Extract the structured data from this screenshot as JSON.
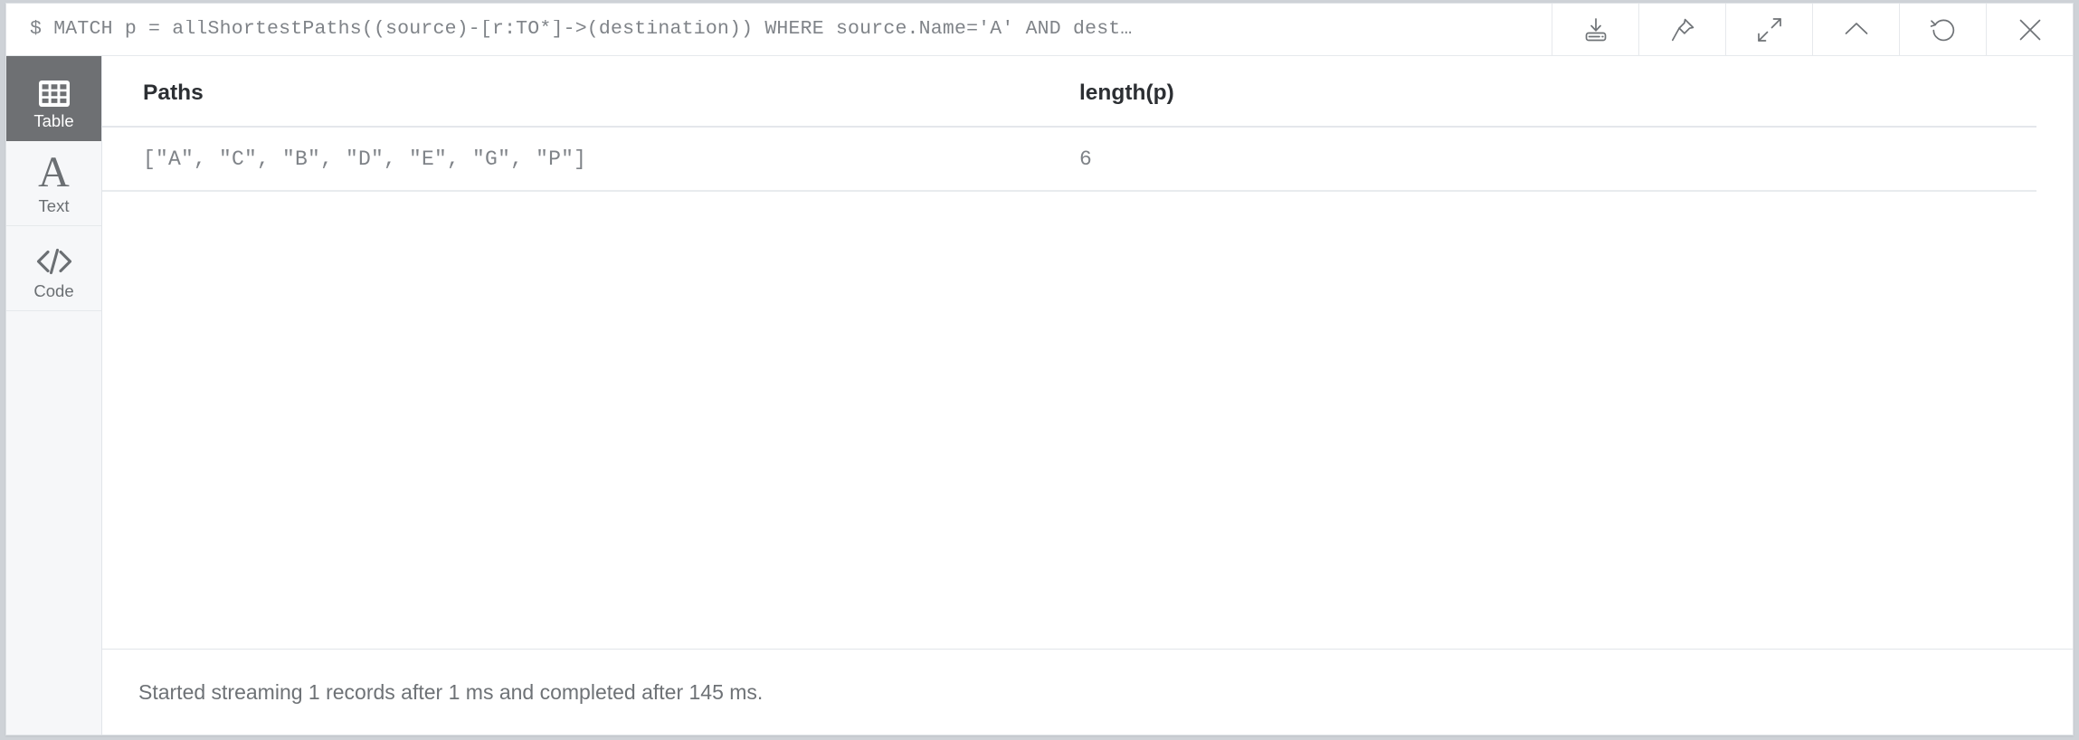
{
  "frame": {
    "query_prompt": "$",
    "query_text": "$ MATCH p = allShortestPaths((source)-[r:TO*]->(destination)) WHERE source.Name='A' AND dest…"
  },
  "toolbar": {
    "buttons": [
      {
        "name": "download-button",
        "icon": "download-icon",
        "label": "Download"
      },
      {
        "name": "pin-button",
        "icon": "pin-icon",
        "label": "Pin"
      },
      {
        "name": "expand-button",
        "icon": "expand-icon",
        "label": "Expand"
      },
      {
        "name": "collapse-button",
        "icon": "chevron-up-icon",
        "label": "Collapse"
      },
      {
        "name": "rerun-button",
        "icon": "refresh-icon",
        "label": "Rerun"
      },
      {
        "name": "close-button",
        "icon": "close-icon",
        "label": "Close"
      }
    ]
  },
  "sidebar": {
    "items": [
      {
        "label": "Table",
        "icon": "table-grid-icon",
        "active": true
      },
      {
        "label": "Text",
        "icon": "letter-a-icon",
        "active": false
      },
      {
        "label": "Code",
        "icon": "code-brackets-icon",
        "active": false
      }
    ]
  },
  "result_table": {
    "columns": [
      "Paths",
      "length(p)"
    ],
    "rows": [
      [
        "[\"A\", \"C\", \"B\", \"D\", \"E\", \"G\", \"P\"]",
        "6"
      ]
    ]
  },
  "status": {
    "message": "Started streaming 1 records after 1 ms and completed after 145 ms.",
    "records": "1",
    "stream_start_ms": "1",
    "completed_ms": "145"
  },
  "colors": {
    "page_background": "#ced2d7",
    "panel_background": "#ffffff",
    "sidebar_background": "#f6f7f9",
    "sidebar_active": "#6e7073",
    "text_muted": "#7f8388",
    "text_strong": "#2c2f33",
    "border": "#e6e9ec"
  }
}
